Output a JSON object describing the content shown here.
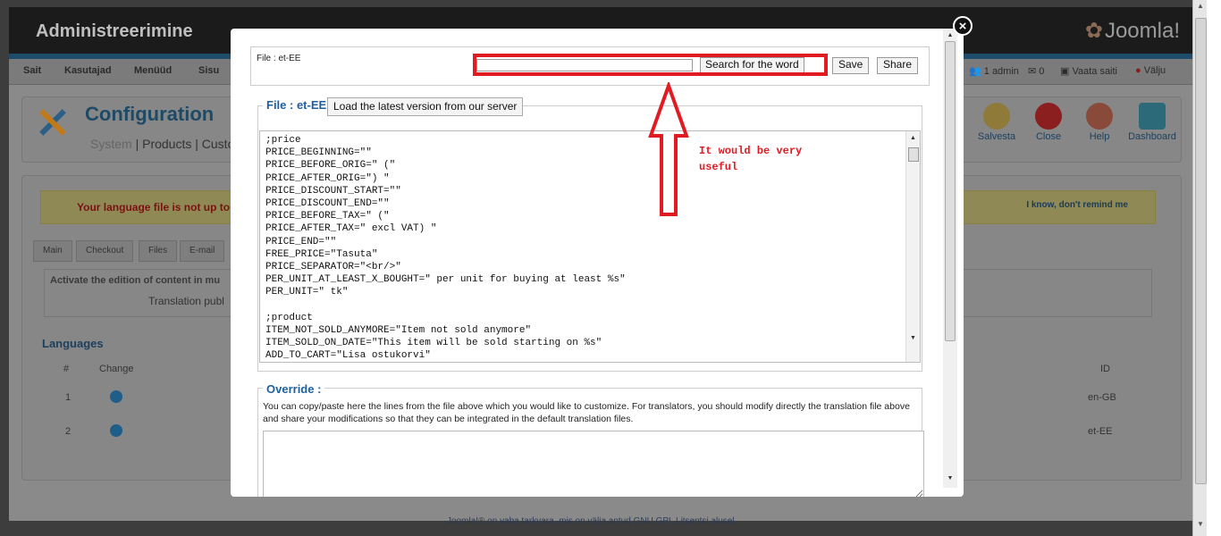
{
  "admin": {
    "title": "Administreerimine",
    "logo_text": "Joomla!",
    "menu": [
      "Sait",
      "Kasutajad",
      "Menüüd",
      "Sisu"
    ],
    "status": {
      "users": "1 admin",
      "messages": "0",
      "view_site": "Vaata saiti",
      "logout": "Välju"
    },
    "page_title": "Configuration",
    "subnav": {
      "system": "System",
      "products": "Products",
      "customers": "Custo"
    },
    "toolbar": {
      "save": "Salvesta",
      "close": "Close",
      "help": "Help",
      "dashboard": "Dashboard"
    },
    "warning": {
      "text": "Your language file is not up to d",
      "dismiss": "I know, don't remind me"
    },
    "tabs": [
      "Main",
      "Checkout",
      "Files",
      "E-mail"
    ],
    "activate_text": "Activate the edition of content in mu",
    "translation_text": "Translation publ",
    "languages": {
      "legend": "Languages",
      "headers": {
        "num": "#",
        "change": "Change",
        "id": "ID"
      },
      "rows": [
        {
          "num": "1",
          "id": "en-GB"
        },
        {
          "num": "2",
          "id": "et-EE"
        }
      ]
    },
    "footer": "Joomla!® on vaba tarkvara, mis on välja antud GNU GPL Litsentsi alusel."
  },
  "modal": {
    "close_label": "×",
    "file_label": "File : et-EE",
    "search": {
      "value": "",
      "button": "Search for the word"
    },
    "save": "Save",
    "share": "Share",
    "file_legend": "File : et-EE",
    "load_button": "Load the latest version from our server",
    "code_lines": [
      ";price",
      "PRICE_BEGINNING=\"\"",
      "PRICE_BEFORE_ORIG=\" (\"",
      "PRICE_AFTER_ORIG=\") \"",
      "PRICE_DISCOUNT_START=\"\"",
      "PRICE_DISCOUNT_END=\"\"",
      "PRICE_BEFORE_TAX=\" (\"",
      "PRICE_AFTER_TAX=\" excl VAT) \"",
      "PRICE_END=\"\"",
      "FREE_PRICE=\"Tasuta\"",
      "PRICE_SEPARATOR=\"<br/>\"",
      "PER_UNIT_AT_LEAST_X_BOUGHT=\" per unit for buying at least %s\"",
      "PER_UNIT=\" tk\"",
      "",
      ";product",
      "ITEM_NOT_SOLD_ANYMORE=\"Item not sold anymore\"",
      "ITEM_SOLD_ON_DATE=\"This item will be sold starting on %s\"",
      "ADD_TO_CART=\"Lisa ostukorvi\""
    ],
    "override_legend": "Override :",
    "override_description": "You can copy/paste here the lines from the file above which you would like to customize. For translators, you should modify directly the translation file above and share your modifications so that they can be integrated in the default translation files.",
    "override_value": ""
  },
  "annotation": {
    "line1": "It would be very",
    "line2": "useful",
    "color": "#e01b22"
  }
}
